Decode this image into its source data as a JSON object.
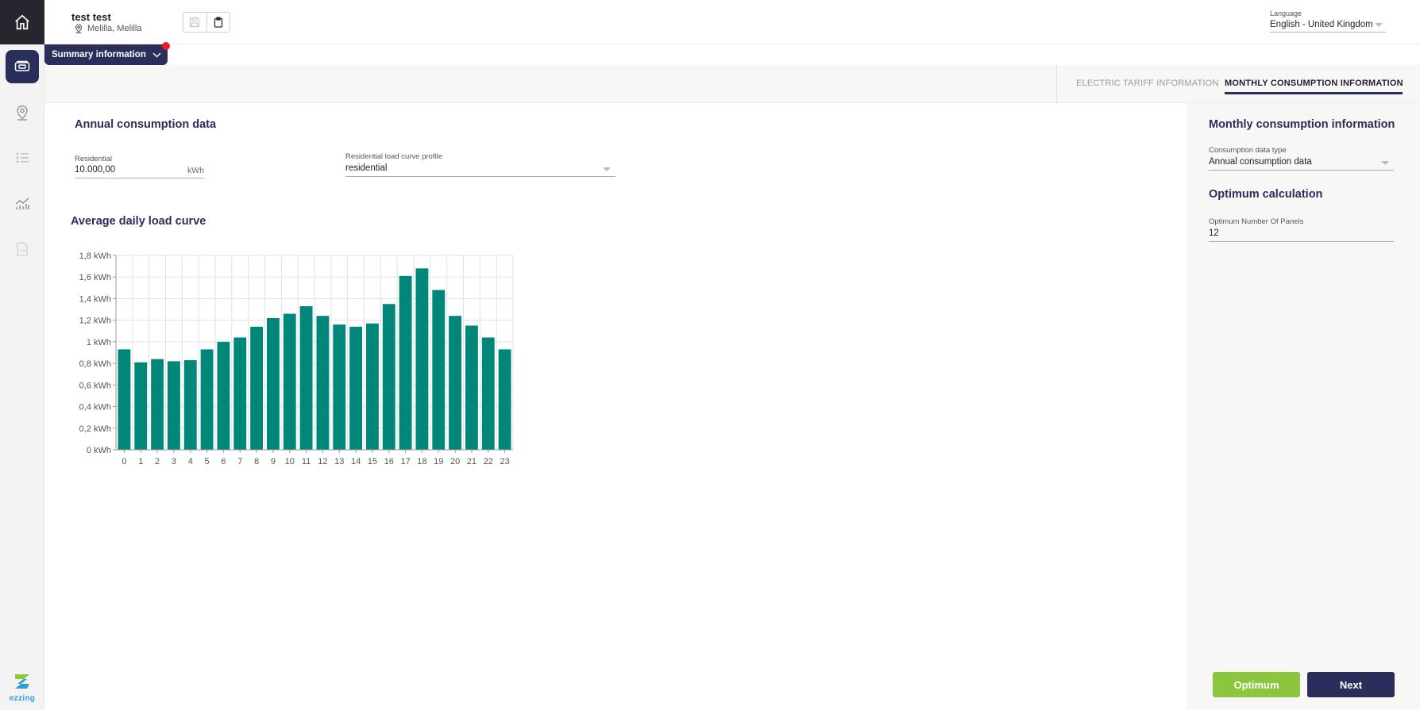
{
  "sidebar": {
    "items": [
      {
        "icon": "home-icon"
      },
      {
        "icon": "wallet-icon",
        "active": true
      },
      {
        "icon": "location-pin-icon"
      },
      {
        "icon": "list-icon"
      },
      {
        "icon": "chart-icon"
      },
      {
        "icon": "pdf-icon"
      }
    ],
    "logo_text": "ezzing"
  },
  "header": {
    "user_name": "test test",
    "user_location": "Melilla, Melilla",
    "language_label": "Language",
    "language_value": "English - United Kingdom"
  },
  "summary": {
    "label": "Summary information"
  },
  "tabs": [
    {
      "label": "ELECTRIC TARIFF INFORMATION",
      "active": false
    },
    {
      "label": "MONTHLY CONSUMPTION INFORMATION",
      "active": true
    }
  ],
  "main": {
    "annual_title": "Annual consumption data",
    "residential": {
      "label": "Residential",
      "value": "10.000,00",
      "unit": "kWh"
    },
    "profile": {
      "label": "Residential load curve profile",
      "value": "residential"
    },
    "chart_title": "Average daily load curve"
  },
  "right_panel": {
    "monthly_title": "Monthly consumption information",
    "consumption_type": {
      "label": "Consumption data type",
      "value": "Annual consumption data"
    },
    "optimum_title": "Optimum calculation",
    "panels": {
      "label": "Optimum Number Of Panels",
      "value": "12"
    }
  },
  "buttons": {
    "optimum": "Optimum",
    "next": "Next"
  },
  "colors": {
    "accent": "#2a2e5a",
    "bar": "#00877a",
    "green": "#8cc63f",
    "alert": "#ee1c25"
  },
  "chart_data": {
    "type": "bar",
    "categories": [
      "0",
      "1",
      "2",
      "3",
      "4",
      "5",
      "6",
      "7",
      "8",
      "9",
      "10",
      "11",
      "12",
      "13",
      "14",
      "15",
      "16",
      "17",
      "18",
      "19",
      "20",
      "21",
      "22",
      "23"
    ],
    "values": [
      0.93,
      0.81,
      0.84,
      0.82,
      0.83,
      0.93,
      1.0,
      1.04,
      1.14,
      1.22,
      1.26,
      1.33,
      1.24,
      1.16,
      1.14,
      1.17,
      1.35,
      1.61,
      1.68,
      1.48,
      1.24,
      1.15,
      1.04,
      0.93
    ],
    "ylim": [
      0,
      1.8
    ],
    "yticks": [
      "0 kWh",
      "0,2 kWh",
      "0,4 kWh",
      "0,6 kWh",
      "0,8 kWh",
      "1 kWh",
      "1,2 kWh",
      "1,4 kWh",
      "1,6 kWh",
      "1,8 kWh"
    ],
    "grid": true
  }
}
